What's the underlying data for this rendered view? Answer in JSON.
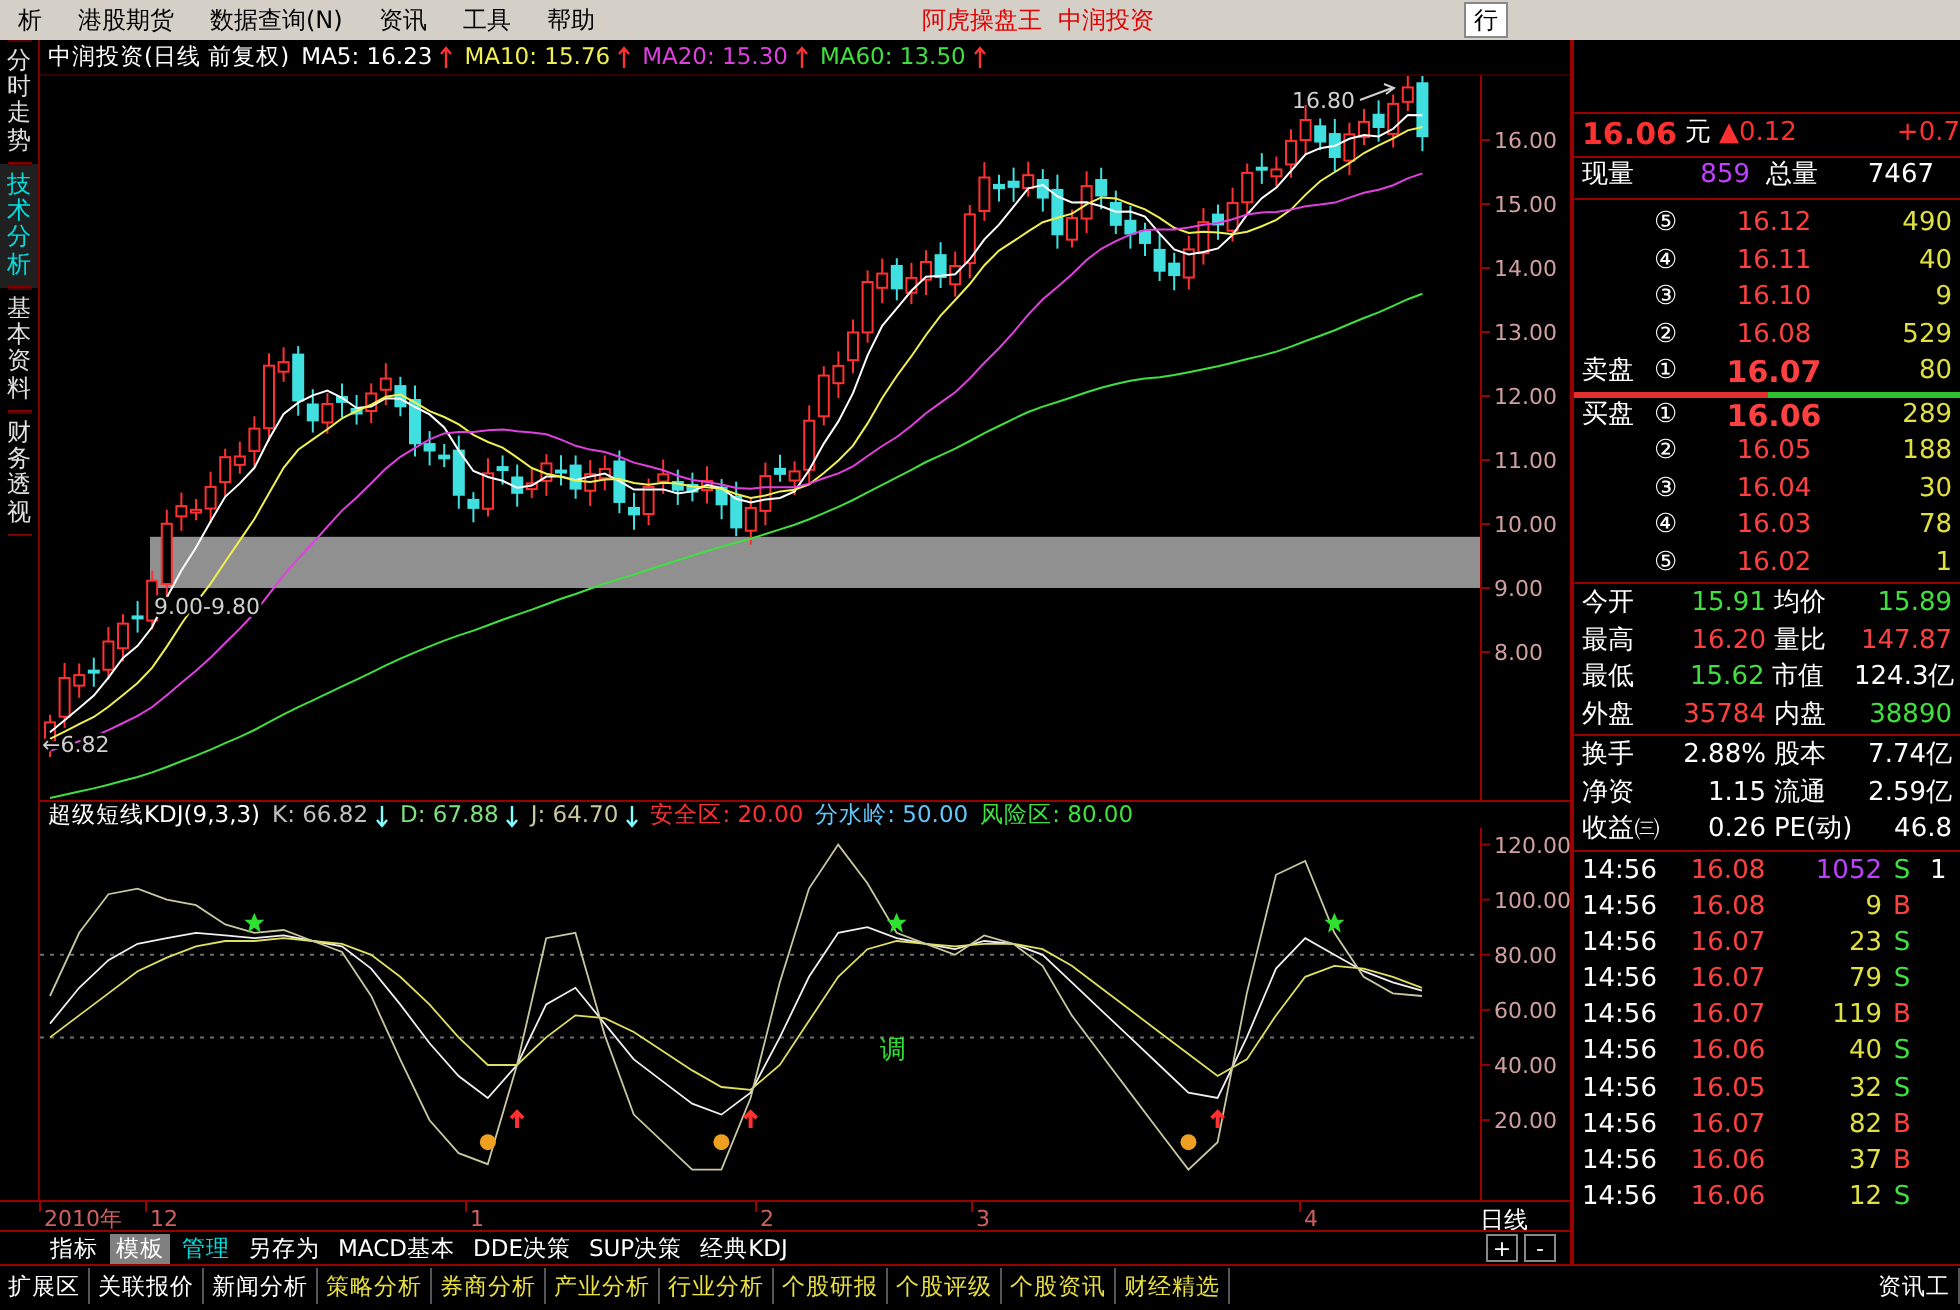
{
  "menu_bar": {
    "items": [
      "析",
      "港股期货",
      "数据查询(N)",
      "资讯",
      "工具",
      "帮助"
    ],
    "title": [
      "阿虎操盘王",
      "中润投资"
    ],
    "right_button": "行"
  },
  "side_tabs": [
    {
      "label": "分时走势",
      "selected": false
    },
    {
      "label": "技术分析",
      "selected": true
    },
    {
      "label": "基本资料",
      "selected": false
    },
    {
      "label": "财务透视",
      "selected": false
    }
  ],
  "price_chart": {
    "stock": "中润投资(日线 前复权)",
    "ma_legend": [
      {
        "label": "MA5: 16.23",
        "color": "#ffffff"
      },
      {
        "label": "MA10: 15.76",
        "color": "#f0f050"
      },
      {
        "label": "MA20: 15.30",
        "color": "#e040e0"
      },
      {
        "label": "MA60: 13.50",
        "color": "#40e040"
      }
    ],
    "axis_labels": [
      "16.00",
      "15.00",
      "14.00",
      "13.00",
      "12.00",
      "11.00",
      "10.00",
      "9.00",
      "8.00"
    ],
    "high_label": "16.80",
    "zone_label": "9.00-9.80",
    "low_label": "←6.82"
  },
  "kdj_panel": {
    "title": "超级短线KDJ(9,3,3)",
    "values": [
      {
        "label": "K: 66.82",
        "color": "#c0c0c0"
      },
      {
        "label": "D: 67.88",
        "color": "#80e080"
      },
      {
        "label": "J: 64.70",
        "color": "#c8c8a0"
      }
    ],
    "zones": [
      {
        "label": "安全区: 20.00",
        "color": "#ff3030"
      },
      {
        "label": "分水岭: 50.00",
        "color": "#60c8ff"
      },
      {
        "label": "风险区: 80.00",
        "color": "#40e040"
      }
    ],
    "chart_data": {
      "type": "line",
      "ylim": [
        -9,
        126
      ],
      "yticks": [
        {
          "value": 120,
          "label": "120.00"
        },
        {
          "value": 100,
          "label": "100.00"
        },
        {
          "value": 80,
          "label": "80.00"
        },
        {
          "value": 60,
          "label": "60.00"
        },
        {
          "value": 40,
          "label": "40.00"
        },
        {
          "value": 20,
          "label": "20.00"
        }
      ],
      "series": [
        {
          "color": "#f0f0f0",
          "values": [
            55,
            68,
            78,
            84,
            86,
            88,
            87,
            86,
            87,
            85,
            83,
            75,
            62,
            48,
            36,
            28,
            40,
            62,
            68,
            55,
            42,
            34,
            26,
            22,
            30,
            50,
            72,
            88,
            90,
            86,
            84,
            82,
            85,
            84,
            80,
            70,
            60,
            50,
            40,
            30,
            28,
            50,
            75,
            86,
            80,
            74,
            70,
            67
          ]
        },
        {
          "color": "#e0e060",
          "values": [
            50,
            58,
            66,
            74,
            79,
            83,
            85,
            85,
            86,
            85,
            84,
            80,
            72,
            62,
            50,
            40,
            40,
            50,
            58,
            57,
            52,
            45,
            38,
            32,
            31,
            40,
            56,
            72,
            82,
            85,
            84,
            83,
            84,
            84,
            82,
            76,
            68,
            60,
            52,
            44,
            36,
            42,
            58,
            72,
            76,
            75,
            72,
            68
          ]
        },
        {
          "color": "#c8c8a0",
          "values": [
            65,
            88,
            102,
            104,
            100,
            98,
            91,
            88,
            89,
            85,
            81,
            65,
            42,
            20,
            8,
            4,
            40,
            86,
            88,
            51,
            22,
            12,
            2,
            2,
            28,
            70,
            104,
            120,
            106,
            88,
            84,
            80,
            87,
            84,
            76,
            58,
            44,
            30,
            16,
            2,
            12,
            66,
            109,
            114,
            88,
            72,
            66,
            65
          ]
        }
      ]
    },
    "marker_text": "调"
  },
  "date_axis": {
    "labels": [
      "2010年",
      "12",
      "1",
      "2",
      "3",
      "4"
    ],
    "period": "日线"
  },
  "indicator_tabs": [
    {
      "label": "指标",
      "selected": false,
      "kind": "tab"
    },
    {
      "label": "模板",
      "selected": true,
      "kind": "tab"
    },
    {
      "label": "管理",
      "selected": false,
      "kind": "action"
    },
    {
      "label": "另存为",
      "selected": false,
      "kind": "tab"
    },
    {
      "label": "MACD基本",
      "selected": false,
      "kind": "tab"
    },
    {
      "label": "DDE决策",
      "selected": false,
      "kind": "tab"
    },
    {
      "label": "SUP决策",
      "selected": false,
      "kind": "tab"
    },
    {
      "label": "经典KDJ",
      "selected": false,
      "kind": "tab"
    }
  ],
  "zoom_buttons": [
    "+",
    "-"
  ],
  "bottom_tabs": [
    {
      "label": "扩展区",
      "kind": "main"
    },
    {
      "label": "关联报价",
      "kind": "main"
    },
    {
      "label": "新闻分析",
      "kind": "main"
    },
    {
      "label": "策略分析",
      "kind": "info"
    },
    {
      "label": "券商分析",
      "kind": "info"
    },
    {
      "label": "产业分析",
      "kind": "info"
    },
    {
      "label": "行业分析",
      "kind": "info"
    },
    {
      "label": "个股研报",
      "kind": "info"
    },
    {
      "label": "个股评级",
      "kind": "info"
    },
    {
      "label": "个股资讯",
      "kind": "info"
    },
    {
      "label": "财经精选",
      "kind": "info"
    }
  ],
  "bottom_right": "资讯工",
  "quote": {
    "price": "16.06",
    "unit": "元",
    "change": "▲0.12",
    "change_pct": "+0.7",
    "volume_row": [
      {
        "label": "现量",
        "value": "859",
        "kind": "accent"
      },
      {
        "label": "总量",
        "value": "7467",
        "kind": "flat"
      }
    ]
  },
  "order_book": {
    "sells": [
      {
        "level": "⑤",
        "price": "16.12",
        "volume": "490"
      },
      {
        "level": "④",
        "price": "16.11",
        "volume": "40"
      },
      {
        "level": "③",
        "price": "16.10",
        "volume": "9"
      },
      {
        "level": "②",
        "price": "16.08",
        "volume": "529"
      },
      {
        "label": "卖盘",
        "level": "①",
        "price": "16.07",
        "volume": "80"
      }
    ],
    "buys": [
      {
        "label": "买盘",
        "level": "①",
        "price": "16.06",
        "volume": "289"
      },
      {
        "level": "②",
        "price": "16.05",
        "volume": "188"
      },
      {
        "level": "③",
        "price": "16.04",
        "volume": "30"
      },
      {
        "level": "④",
        "price": "16.03",
        "volume": "78"
      },
      {
        "level": "⑤",
        "price": "16.02",
        "volume": "1"
      }
    ]
  },
  "stats": [
    [
      {
        "label": "今开",
        "value": "15.91",
        "kind": "down"
      },
      {
        "label": "均价",
        "value": "15.89",
        "kind": "down"
      }
    ],
    [
      {
        "label": "最高",
        "value": "16.20",
        "kind": "up"
      },
      {
        "label": "量比",
        "value": "147.87",
        "kind": "up"
      }
    ],
    [
      {
        "label": "最低",
        "value": "15.62",
        "kind": "down"
      },
      {
        "label": "市值",
        "value": "124.3亿",
        "kind": "flat"
      }
    ],
    [
      {
        "label": "外盘",
        "value": "35784",
        "kind": "up"
      },
      {
        "label": "内盘",
        "value": "38890",
        "kind": "down"
      }
    ]
  ],
  "finance": [
    [
      {
        "label": "换手",
        "value": "2.88%"
      },
      {
        "label": "股本",
        "value": "7.74亿"
      }
    ],
    [
      {
        "label": "净资",
        "value": "1.15"
      },
      {
        "label": "流通",
        "value": "2.59亿"
      }
    ],
    [
      {
        "label": "收益㈢",
        "value": "0.26"
      },
      {
        "label": "PE(动)",
        "value": "46.8"
      }
    ]
  ],
  "trades": [
    {
      "time": "14:56",
      "price": "16.08",
      "volume": "1052",
      "large": true,
      "side": "S",
      "kind": "sell",
      "column_5": "1"
    },
    {
      "time": "14:56",
      "price": "16.08",
      "volume": "9",
      "large": false,
      "side": "B",
      "kind": "buy"
    },
    {
      "time": "14:56",
      "price": "16.07",
      "volume": "23",
      "large": false,
      "side": "S",
      "kind": "sell"
    },
    {
      "time": "14:56",
      "price": "16.07",
      "volume": "79",
      "large": false,
      "side": "S",
      "kind": "sell"
    },
    {
      "time": "14:56",
      "price": "16.07",
      "volume": "119",
      "large": false,
      "side": "B",
      "kind": "buy"
    },
    {
      "time": "14:56",
      "price": "16.06",
      "volume": "40",
      "large": false,
      "side": "S",
      "kind": "sell"
    },
    {
      "time": "14:56",
      "price": "16.05",
      "volume": "32",
      "large": false,
      "side": "S",
      "kind": "sell"
    },
    {
      "time": "14:56",
      "price": "16.07",
      "volume": "82",
      "large": false,
      "side": "B",
      "kind": "buy"
    },
    {
      "time": "14:56",
      "price": "16.06",
      "volume": "37",
      "large": false,
      "side": "B",
      "kind": "buy"
    },
    {
      "time": "14:56",
      "price": "16.06",
      "volume": "12",
      "large": false,
      "side": "S",
      "kind": "sell"
    }
  ]
}
